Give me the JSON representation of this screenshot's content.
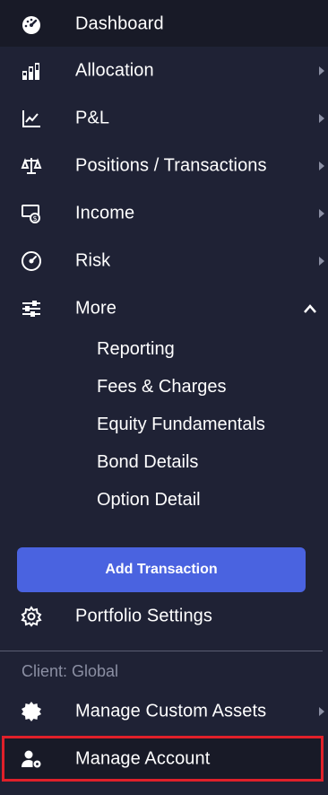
{
  "nav": {
    "dashboard": "Dashboard",
    "allocation": "Allocation",
    "pnl": "P&L",
    "positions": "Positions / Transactions",
    "income": "Income",
    "risk": "Risk",
    "more": "More"
  },
  "more_submenu": [
    "Reporting",
    "Fees & Charges",
    "Equity Fundamentals",
    "Bond Details",
    "Option Detail"
  ],
  "add_transaction_label": "Add Transaction",
  "portfolio_settings": "Portfolio Settings",
  "client_label": "Client: Global",
  "manage_custom_assets": "Manage Custom Assets",
  "manage_account": "Manage Account",
  "colors": {
    "background": "#1f2235",
    "accent": "#4a63e0",
    "highlight": "#e0202a"
  }
}
